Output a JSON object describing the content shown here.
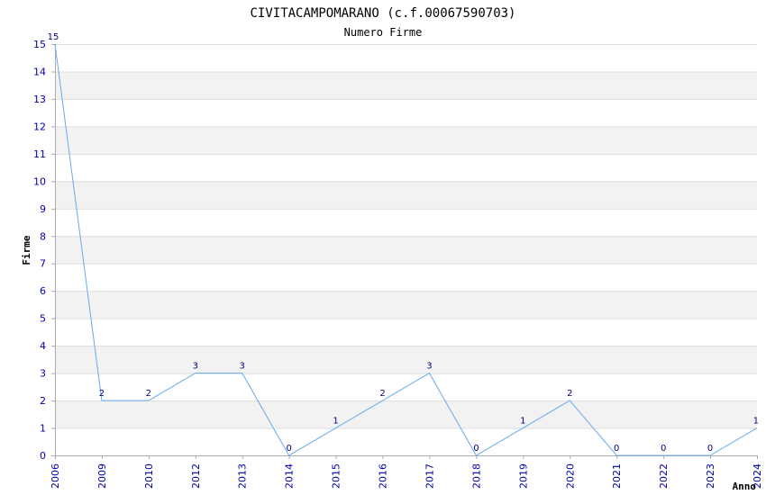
{
  "chart_data": {
    "type": "line",
    "title": "CIVITACAMPOMARANO (c.f.00067590703)",
    "subtitle": "Numero Firme",
    "xlabel": "Anno",
    "ylabel": "Firme",
    "categories": [
      "2006",
      "2009",
      "2010",
      "2012",
      "2013",
      "2014",
      "2015",
      "2016",
      "2017",
      "2018",
      "2019",
      "2020",
      "2021",
      "2022",
      "2023",
      "2024"
    ],
    "series": [
      {
        "values": [
          15,
          2,
          2,
          3,
          3,
          0,
          1,
          2,
          3,
          0,
          1,
          2,
          0,
          0,
          0,
          1
        ]
      }
    ],
    "ylim": [
      0,
      15
    ],
    "yticks": [
      0,
      1,
      2,
      3,
      4,
      5,
      6,
      7,
      8,
      9,
      10,
      11,
      12,
      13,
      14,
      15
    ],
    "grid": true,
    "band_colors": [
      "#f2f2f2",
      "#ffffff"
    ],
    "line_color": "#66aaee",
    "tick_color": "#0000aa",
    "label_color": "#000080"
  }
}
